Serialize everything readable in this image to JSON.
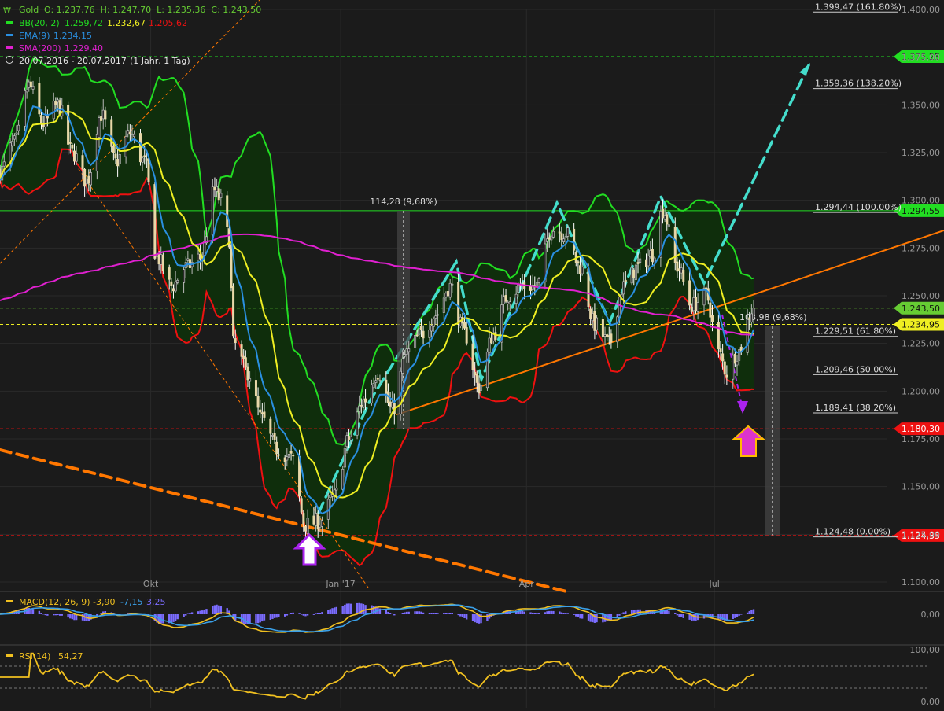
{
  "header": {
    "symbol": "Gold",
    "ohlc": "O: 1.237,76  H: 1.247,70  L: 1.235,36  C: 1.243,50",
    "bb_label": "BB(20, 2)",
    "bb_values": [
      "1.259,72",
      "1.232,67",
      "1.205,62"
    ],
    "ema_label": "EMA(9)",
    "ema_value": "1.234,15",
    "sma_label": "SMA(200)",
    "sma_value": "1.229,40",
    "range_text": "20.07.2016 - 20.07.2017",
    "range_detail": "(1 Jahr, 1 Tag)"
  },
  "colors": {
    "background": "#1b1b1b",
    "grid": "#2a2a2a",
    "price_up": "#c8c8c8",
    "price_down": "#ffffff",
    "bb_upper": "#22dd22",
    "bb_mid": "#eeee22",
    "bb_lower": "#ee1111",
    "bb_fill": "#0f2e0c",
    "ema": "#2a8fe0",
    "sma": "#e020d0",
    "orange": "#ff7700",
    "cyan": "#44ddcc",
    "purple": "#aa22ee",
    "macd_line": "#f0c020",
    "macd_signal": "#3aa0e8",
    "macd_hist": "#7b6cff",
    "rsi": "#f0c020"
  },
  "chart_data": {
    "type": "candlestick",
    "title": "Gold",
    "x_axis": {
      "start": "20.07.2016",
      "end": "20.07.2017",
      "month_labels": [
        {
          "label": "Okt",
          "date": "2016-10-01"
        },
        {
          "label": "Jan '17",
          "date": "2017-01-01"
        },
        {
          "label": "Apr",
          "date": "2017-04-01"
        },
        {
          "label": "Jul",
          "date": "2017-07-01"
        }
      ]
    },
    "y_axis": {
      "min": 1085,
      "max": 1405,
      "ticks": [
        "1.400,00",
        "1.375,00",
        "1.350,00",
        "1.325,00",
        "1.300,00",
        "1.275,00",
        "1.250,00",
        "1.225,00",
        "1.200,00",
        "1.175,00",
        "1.150,00",
        "1.125,00",
        "1.100,00"
      ],
      "tick_values": [
        1400,
        1375,
        1350,
        1325,
        1300,
        1275,
        1250,
        1225,
        1200,
        1175,
        1150,
        1125,
        1100
      ]
    },
    "price_path": [
      [
        "2016-07-20",
        1315
      ],
      [
        "2016-07-27",
        1330
      ],
      [
        "2016-08-03",
        1360
      ],
      [
        "2016-08-10",
        1340
      ],
      [
        "2016-08-17",
        1350
      ],
      [
        "2016-08-24",
        1325
      ],
      [
        "2016-08-31",
        1310
      ],
      [
        "2016-09-07",
        1345
      ],
      [
        "2016-09-14",
        1320
      ],
      [
        "2016-09-21",
        1335
      ],
      [
        "2016-09-28",
        1320
      ],
      [
        "2016-10-04",
        1270
      ],
      [
        "2016-10-11",
        1255
      ],
      [
        "2016-10-18",
        1265
      ],
      [
        "2016-10-25",
        1270
      ],
      [
        "2016-11-01",
        1305
      ],
      [
        "2016-11-04",
        1300
      ],
      [
        "2016-11-08",
        1280
      ],
      [
        "2016-11-10",
        1225
      ],
      [
        "2016-11-17",
        1210
      ],
      [
        "2016-11-24",
        1185
      ],
      [
        "2016-12-01",
        1170
      ],
      [
        "2016-12-08",
        1165
      ],
      [
        "2016-12-15",
        1130
      ],
      [
        "2016-12-22",
        1132
      ],
      [
        "2016-12-29",
        1145
      ],
      [
        "2017-01-05",
        1175
      ],
      [
        "2017-01-12",
        1195
      ],
      [
        "2017-01-19",
        1210
      ],
      [
        "2017-01-26",
        1190
      ],
      [
        "2017-02-02",
        1220
      ],
      [
        "2017-02-09",
        1230
      ],
      [
        "2017-02-16",
        1240
      ],
      [
        "2017-02-23",
        1255
      ],
      [
        "2017-03-02",
        1230
      ],
      [
        "2017-03-09",
        1202
      ],
      [
        "2017-03-16",
        1230
      ],
      [
        "2017-03-23",
        1250
      ],
      [
        "2017-03-30",
        1255
      ],
      [
        "2017-04-06",
        1255
      ],
      [
        "2017-04-13",
        1285
      ],
      [
        "2017-04-20",
        1283
      ],
      [
        "2017-04-27",
        1265
      ],
      [
        "2017-05-04",
        1235
      ],
      [
        "2017-05-11",
        1225
      ],
      [
        "2017-05-18",
        1255
      ],
      [
        "2017-05-25",
        1265
      ],
      [
        "2017-06-01",
        1272
      ],
      [
        "2017-06-06",
        1295
      ],
      [
        "2017-06-13",
        1265
      ],
      [
        "2017-06-20",
        1245
      ],
      [
        "2017-06-27",
        1250
      ],
      [
        "2017-07-03",
        1220
      ],
      [
        "2017-07-07",
        1210
      ],
      [
        "2017-07-12",
        1220
      ],
      [
        "2017-07-20",
        1243.5
      ]
    ],
    "series": [
      {
        "name": "BB(20, 2)",
        "last": [
          1259.72,
          1232.67,
          1205.62
        ]
      },
      {
        "name": "EMA(9)",
        "last": 1234.15
      },
      {
        "name": "SMA(200)",
        "last": 1229.4
      }
    ],
    "horizontal_levels": [
      {
        "value": 1375.25,
        "label": "1.375,25",
        "color": "#22dd22"
      },
      {
        "value": 1294.55,
        "label": "1.294,55",
        "color": "#22dd22"
      },
      {
        "value": 1243.5,
        "label": "1.243,50",
        "color": "#66cc33"
      },
      {
        "value": 1234.95,
        "label": "1.234,95",
        "color": "#eeee22"
      },
      {
        "value": 1180.3,
        "label": "1.180,30",
        "color": "#ee1111"
      },
      {
        "value": 1124.35,
        "label": "1.124,35",
        "color": "#ee1111"
      }
    ],
    "fibonacci": [
      {
        "value": 1399.47,
        "label": "1.399,47 (161.80%)"
      },
      {
        "value": 1359.36,
        "label": "1.359,36 (138.20%)"
      },
      {
        "value": 1294.44,
        "label": "1.294,44 (100.00%)"
      },
      {
        "value": 1229.51,
        "label": "1.229,51 (61.80%)"
      },
      {
        "value": 1209.46,
        "label": "1.209,46 (50.00%)"
      },
      {
        "value": 1189.41,
        "label": "1.189,41 (38.20%)"
      },
      {
        "value": 1124.48,
        "label": "1.124,48 (0.00%)"
      }
    ],
    "measure_labels": [
      "114,28 (9,68%)",
      "108,98 (9,68%)"
    ],
    "macd": {
      "label": "MACD(12, 26, 9)",
      "values": [
        "-3,90",
        "-7,15",
        "3,25"
      ],
      "axis": "0,00"
    },
    "rsi": {
      "label": "RSI(14)",
      "value": "54,27",
      "axis_top": "100,00",
      "axis_bottom": "0,00"
    }
  }
}
